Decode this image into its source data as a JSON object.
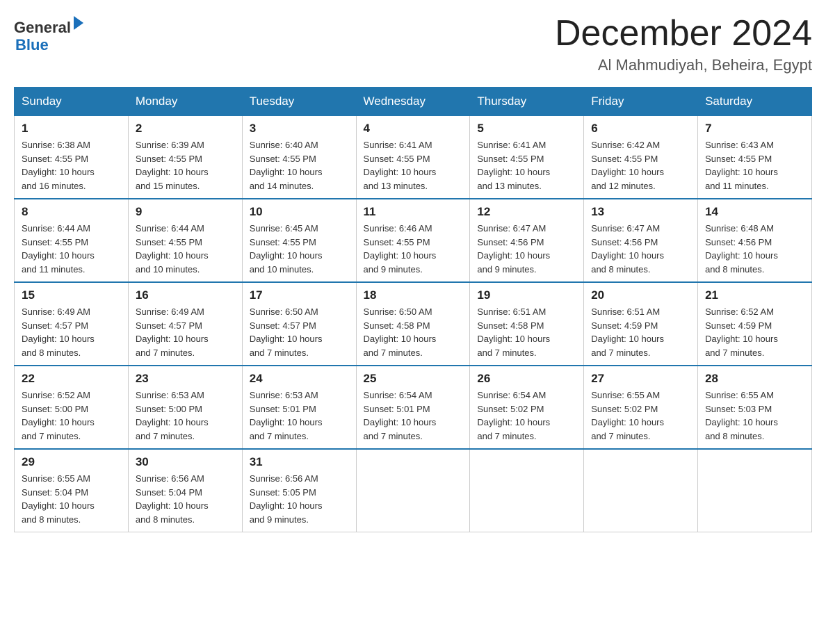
{
  "header": {
    "logo_line1": "General",
    "logo_line2": "Blue",
    "month_title": "December 2024",
    "location": "Al Mahmudiyah, Beheira, Egypt"
  },
  "days_of_week": [
    "Sunday",
    "Monday",
    "Tuesday",
    "Wednesday",
    "Thursday",
    "Friday",
    "Saturday"
  ],
  "weeks": [
    [
      {
        "day": "1",
        "info": "Sunrise: 6:38 AM\nSunset: 4:55 PM\nDaylight: 10 hours\nand 16 minutes."
      },
      {
        "day": "2",
        "info": "Sunrise: 6:39 AM\nSunset: 4:55 PM\nDaylight: 10 hours\nand 15 minutes."
      },
      {
        "day": "3",
        "info": "Sunrise: 6:40 AM\nSunset: 4:55 PM\nDaylight: 10 hours\nand 14 minutes."
      },
      {
        "day": "4",
        "info": "Sunrise: 6:41 AM\nSunset: 4:55 PM\nDaylight: 10 hours\nand 13 minutes."
      },
      {
        "day": "5",
        "info": "Sunrise: 6:41 AM\nSunset: 4:55 PM\nDaylight: 10 hours\nand 13 minutes."
      },
      {
        "day": "6",
        "info": "Sunrise: 6:42 AM\nSunset: 4:55 PM\nDaylight: 10 hours\nand 12 minutes."
      },
      {
        "day": "7",
        "info": "Sunrise: 6:43 AM\nSunset: 4:55 PM\nDaylight: 10 hours\nand 11 minutes."
      }
    ],
    [
      {
        "day": "8",
        "info": "Sunrise: 6:44 AM\nSunset: 4:55 PM\nDaylight: 10 hours\nand 11 minutes."
      },
      {
        "day": "9",
        "info": "Sunrise: 6:44 AM\nSunset: 4:55 PM\nDaylight: 10 hours\nand 10 minutes."
      },
      {
        "day": "10",
        "info": "Sunrise: 6:45 AM\nSunset: 4:55 PM\nDaylight: 10 hours\nand 10 minutes."
      },
      {
        "day": "11",
        "info": "Sunrise: 6:46 AM\nSunset: 4:55 PM\nDaylight: 10 hours\nand 9 minutes."
      },
      {
        "day": "12",
        "info": "Sunrise: 6:47 AM\nSunset: 4:56 PM\nDaylight: 10 hours\nand 9 minutes."
      },
      {
        "day": "13",
        "info": "Sunrise: 6:47 AM\nSunset: 4:56 PM\nDaylight: 10 hours\nand 8 minutes."
      },
      {
        "day": "14",
        "info": "Sunrise: 6:48 AM\nSunset: 4:56 PM\nDaylight: 10 hours\nand 8 minutes."
      }
    ],
    [
      {
        "day": "15",
        "info": "Sunrise: 6:49 AM\nSunset: 4:57 PM\nDaylight: 10 hours\nand 8 minutes."
      },
      {
        "day": "16",
        "info": "Sunrise: 6:49 AM\nSunset: 4:57 PM\nDaylight: 10 hours\nand 7 minutes."
      },
      {
        "day": "17",
        "info": "Sunrise: 6:50 AM\nSunset: 4:57 PM\nDaylight: 10 hours\nand 7 minutes."
      },
      {
        "day": "18",
        "info": "Sunrise: 6:50 AM\nSunset: 4:58 PM\nDaylight: 10 hours\nand 7 minutes."
      },
      {
        "day": "19",
        "info": "Sunrise: 6:51 AM\nSunset: 4:58 PM\nDaylight: 10 hours\nand 7 minutes."
      },
      {
        "day": "20",
        "info": "Sunrise: 6:51 AM\nSunset: 4:59 PM\nDaylight: 10 hours\nand 7 minutes."
      },
      {
        "day": "21",
        "info": "Sunrise: 6:52 AM\nSunset: 4:59 PM\nDaylight: 10 hours\nand 7 minutes."
      }
    ],
    [
      {
        "day": "22",
        "info": "Sunrise: 6:52 AM\nSunset: 5:00 PM\nDaylight: 10 hours\nand 7 minutes."
      },
      {
        "day": "23",
        "info": "Sunrise: 6:53 AM\nSunset: 5:00 PM\nDaylight: 10 hours\nand 7 minutes."
      },
      {
        "day": "24",
        "info": "Sunrise: 6:53 AM\nSunset: 5:01 PM\nDaylight: 10 hours\nand 7 minutes."
      },
      {
        "day": "25",
        "info": "Sunrise: 6:54 AM\nSunset: 5:01 PM\nDaylight: 10 hours\nand 7 minutes."
      },
      {
        "day": "26",
        "info": "Sunrise: 6:54 AM\nSunset: 5:02 PM\nDaylight: 10 hours\nand 7 minutes."
      },
      {
        "day": "27",
        "info": "Sunrise: 6:55 AM\nSunset: 5:02 PM\nDaylight: 10 hours\nand 7 minutes."
      },
      {
        "day": "28",
        "info": "Sunrise: 6:55 AM\nSunset: 5:03 PM\nDaylight: 10 hours\nand 8 minutes."
      }
    ],
    [
      {
        "day": "29",
        "info": "Sunrise: 6:55 AM\nSunset: 5:04 PM\nDaylight: 10 hours\nand 8 minutes."
      },
      {
        "day": "30",
        "info": "Sunrise: 6:56 AM\nSunset: 5:04 PM\nDaylight: 10 hours\nand 8 minutes."
      },
      {
        "day": "31",
        "info": "Sunrise: 6:56 AM\nSunset: 5:05 PM\nDaylight: 10 hours\nand 9 minutes."
      },
      {
        "day": "",
        "info": ""
      },
      {
        "day": "",
        "info": ""
      },
      {
        "day": "",
        "info": ""
      },
      {
        "day": "",
        "info": ""
      }
    ]
  ]
}
